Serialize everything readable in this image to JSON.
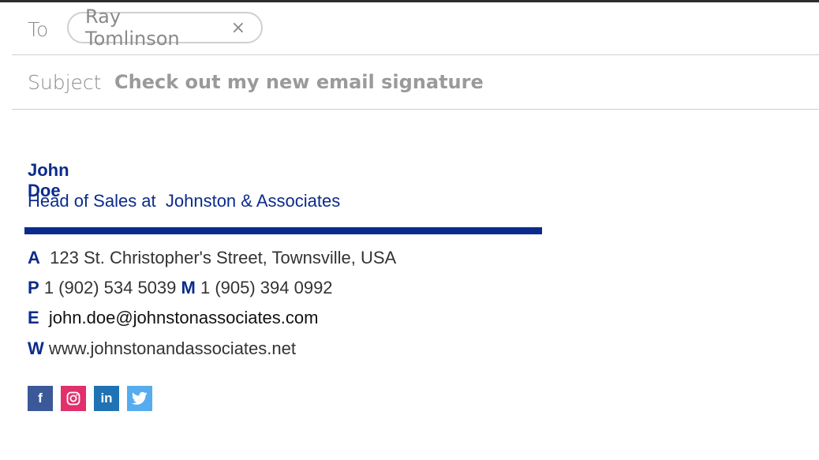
{
  "compose": {
    "to_label": "To",
    "recipient": "Ray Tomlinson",
    "remove_glyph": "×",
    "subject_label": "Subject",
    "subject": "Check out my new email signature"
  },
  "signature": {
    "name": "John Doe",
    "title": "Head of Sales at  Johnston & Associates",
    "address_key": "A",
    "address": "123 St. Christopher's Street, Townsville, USA",
    "phone_key": "P",
    "phone": "1 (902) 534 5039",
    "mobile_key": "M",
    "mobile": "1 (905) 394 0992",
    "email_key": "E",
    "email": "john.doe@johnstonassociates.com",
    "web_key": "W",
    "web": "www.johnstonandassociates.net",
    "accent_color": "#0b2b8c"
  },
  "social": [
    {
      "name": "facebook-icon",
      "glyph": "f",
      "color": "#3b5998"
    },
    {
      "name": "instagram-icon",
      "glyph": "◎",
      "color": "#e1306c"
    },
    {
      "name": "linkedin-icon",
      "glyph": "in",
      "color": "#1f72b3"
    },
    {
      "name": "twitter-icon",
      "glyph": "🐦",
      "color": "#55acee"
    }
  ]
}
